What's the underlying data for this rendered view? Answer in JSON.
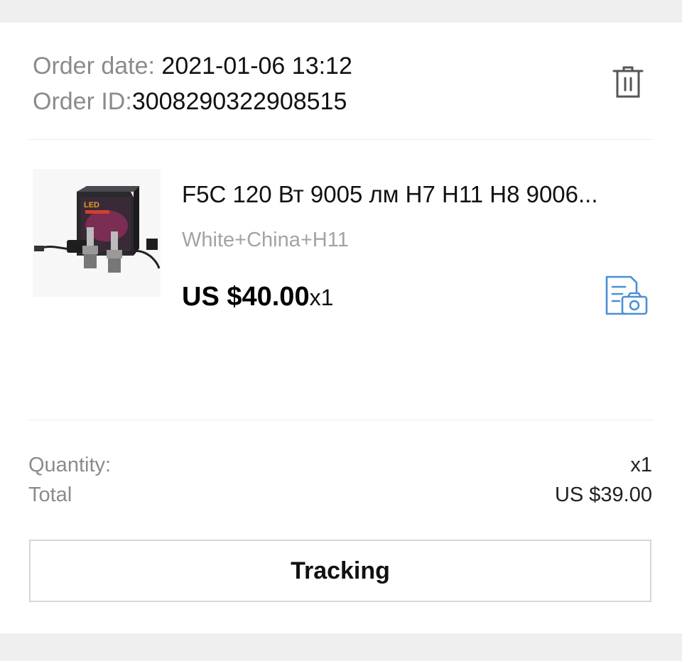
{
  "order": {
    "date_label": "Order date: ",
    "date_value": "2021-01-06 13:12",
    "id_label": "Order ID:",
    "id_value": "3008290322908515"
  },
  "product": {
    "image_label": "LED",
    "title": "F5C 120 Вт 9005 лм H7 H11 H8 9006...",
    "variant": "White+China+H11",
    "price": "US $40.00",
    "quantity": "x1"
  },
  "summary": {
    "quantity_label": "Quantity:",
    "quantity_value": "x1",
    "total_label": "Total",
    "total_value": "US $39.00"
  },
  "actions": {
    "tracking_label": "Tracking"
  },
  "icons": {
    "delete": "trash-icon",
    "review": "photo-review-icon"
  },
  "colors": {
    "accent": "#4a8fd6",
    "muted_text": "#8b8b8b",
    "background": "#efefef"
  }
}
